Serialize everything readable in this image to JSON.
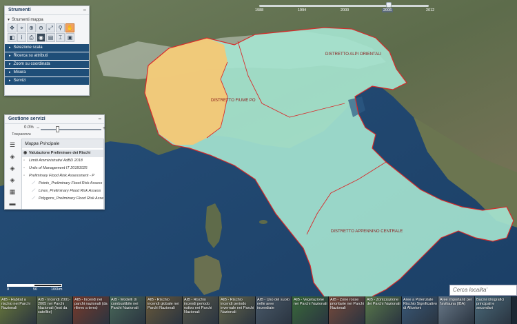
{
  "timeline": {
    "years": [
      "1988",
      "1994",
      "2000",
      "2006",
      "2012"
    ],
    "selected_year": "2006"
  },
  "strumenti": {
    "title": "Strumenti",
    "minimize": "−",
    "toolbar_title": "Strumenti mappa",
    "tools": [
      {
        "name": "pan-icon",
        "glyph": "✥"
      },
      {
        "name": "identify-icon",
        "glyph": "⌖"
      },
      {
        "name": "zoom-in-icon",
        "glyph": "⊕"
      },
      {
        "name": "zoom-out-icon",
        "glyph": "⊖"
      },
      {
        "name": "zoom-extent-icon",
        "glyph": "⤢"
      },
      {
        "name": "magnify-icon",
        "glyph": "⚲"
      },
      {
        "name": "hand-icon",
        "glyph": "✋"
      },
      {
        "name": "previous-extent-icon",
        "glyph": "◧"
      },
      {
        "name": "info-icon",
        "glyph": "i"
      },
      {
        "name": "print-icon",
        "glyph": "⎙"
      },
      {
        "name": "globe-icon",
        "glyph": "◉"
      },
      {
        "name": "layers-tool-icon",
        "glyph": "▤"
      },
      {
        "name": "measure-tool-icon",
        "glyph": "⌶"
      },
      {
        "name": "bookmark-icon",
        "glyph": "▣"
      }
    ],
    "menu": [
      "Selezione scala",
      "Ricerca su attributi",
      "Zoom su coordinata",
      "Misura",
      "Servizi"
    ]
  },
  "servizi": {
    "title": "Gestione servizi",
    "minimize": "−",
    "transparency_value": "0.0%",
    "transparency_label": "Trasparenza",
    "minus": "−",
    "plus": "+",
    "side_icons": [
      {
        "name": "list-icon",
        "glyph": "☰"
      },
      {
        "name": "layers-icon",
        "glyph": "◈"
      },
      {
        "name": "layers-stack-icon",
        "glyph": "◈"
      },
      {
        "name": "layers-alt-icon",
        "glyph": "◈"
      },
      {
        "name": "calendar-icon",
        "glyph": "▦"
      },
      {
        "name": "folder-icon",
        "glyph": "▬"
      }
    ],
    "tree_title": "Mappa Principale",
    "tree": [
      {
        "label": "Valutazione Preliminare dei Rischi",
        "kind": "group"
      },
      {
        "label": "Limiti Amministrativi AdBD 2018",
        "kind": "layer"
      },
      {
        "label": "Units of Management IT 20181025",
        "kind": "layer"
      },
      {
        "label": "Preliminary Flood Risk Assessment - P",
        "kind": "layer"
      },
      {
        "label": "Points_Preliminary Flood Risk Assess",
        "kind": "sub"
      },
      {
        "label": "Lines_Preliminary Flood Risk Assess",
        "kind": "sub"
      },
      {
        "label": "Polygons_Preliminary Flood Risk Asses",
        "kind": "sub"
      }
    ]
  },
  "map": {
    "districts": [
      "DISTRETTO FIUME PO",
      "DISTRETTO ALPI ORIENTALI",
      "DISTRETTO APPENNINO CENTRALE"
    ],
    "scale_labels": [
      "0",
      "50",
      "100km"
    ]
  },
  "search": {
    "placeholder": "Cerca localita'"
  },
  "thumbnails": [
    {
      "label": "AIB - Habitat a rischio nei Parchi Nazionali",
      "color": "#6a7a3a"
    },
    {
      "label": "AIB - Incendi 2001-2005 nei Parchi Nazionali (test da satellite)",
      "color": "#5a6a4a"
    },
    {
      "label": "AIB - Incendi nei parchi nazionali (da rilievo a terra)",
      "color": "#7a3a2a"
    },
    {
      "label": "AIB - Modelli di combustibile nei Parchi Nazionali",
      "color": "#4a6a5a"
    },
    {
      "label": "AIB - Rischio incendi globale nei Parchi Nazionali",
      "color": "#6a5a3a"
    },
    {
      "label": "AIB - Rischio incendi periodo estivo nei Parchi Nazionali",
      "color": "#5a5a4a"
    },
    {
      "label": "AIB - Rischio incendi periodo invernale nei Parchi Nazionali",
      "color": "#6a6a4a"
    },
    {
      "label": "AIB - Uso del suolo nelle aree incendiate",
      "color": "#4a5a6a"
    },
    {
      "label": "AIB - Vegetazione nei Parchi Nazionali",
      "color": "#3a6a3a"
    },
    {
      "label": "AIB - Zone rosse prioritarie nei Parchi Nazionali",
      "color": "#7a4a3a"
    },
    {
      "label": "AIB - Zonizzazione dei Parchi Nazionali",
      "color": "#5a7a4a"
    },
    {
      "label": "Aree a Potenziale Rischio Significativo di Alluvioni",
      "color": "#3a5a7a"
    },
    {
      "label": "Aree importanti per l'avifauna (IBA)",
      "color": "#6a7a8a"
    },
    {
      "label": "Bacini idrografici principali e secondari",
      "color": "#4a6a7a"
    }
  ]
}
